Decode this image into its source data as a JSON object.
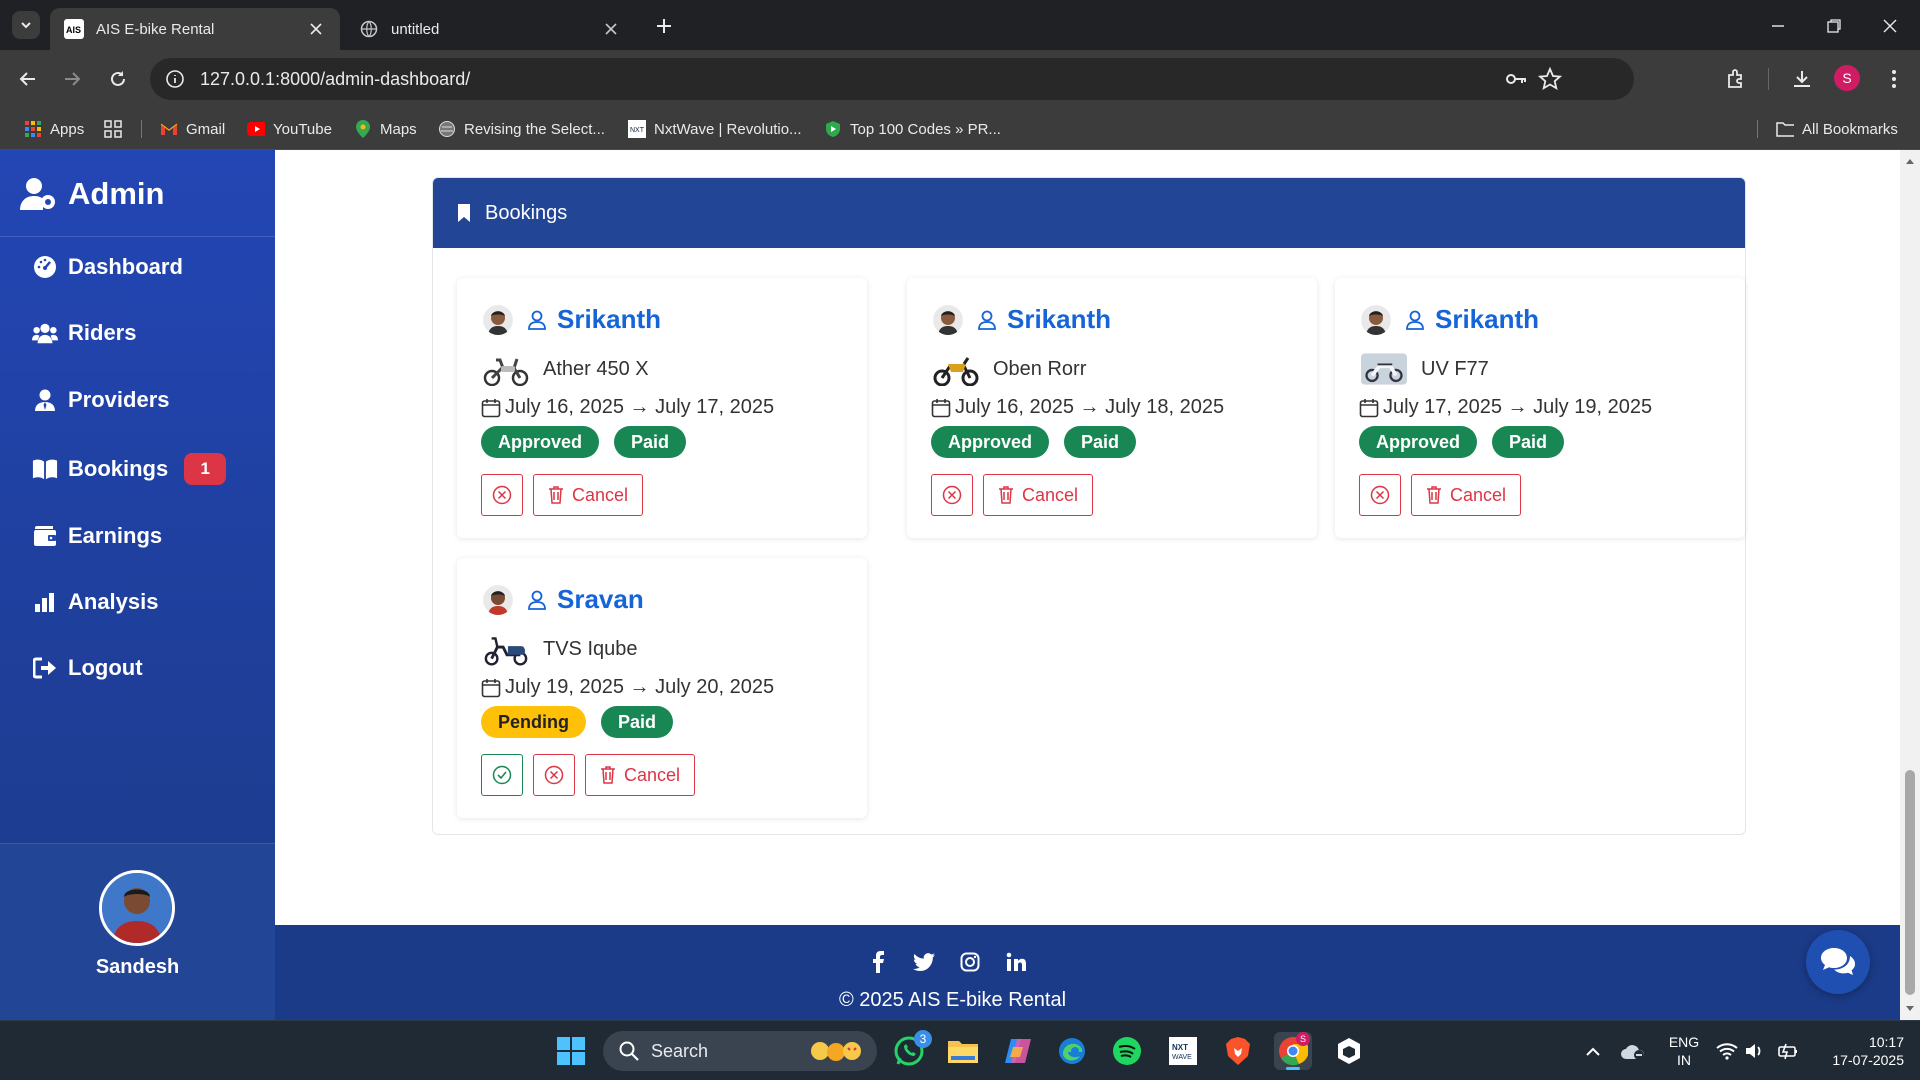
{
  "browser": {
    "tabs": [
      {
        "title": "AIS E-bike Rental",
        "active": true
      },
      {
        "title": "untitled",
        "active": false
      }
    ],
    "url": "127.0.0.1:8000/admin-dashboard/",
    "profile_letter": "S",
    "bookmarks": [
      "Apps",
      "Gmail",
      "YouTube",
      "Maps",
      "Revising the Select...",
      "NxtWave | Revolutio...",
      "Top 100 Codes » PR..."
    ],
    "all_bookmarks": "All Bookmarks"
  },
  "sidebar": {
    "brand": "Admin",
    "items": [
      {
        "label": "Dashboard",
        "icon": "gauge-icon"
      },
      {
        "label": "Riders",
        "icon": "users-icon"
      },
      {
        "label": "Providers",
        "icon": "user-tie-icon"
      },
      {
        "label": "Bookings",
        "icon": "book-open-icon",
        "badge": "1"
      },
      {
        "label": "Earnings",
        "icon": "wallet-icon"
      },
      {
        "label": "Analysis",
        "icon": "bar-chart-icon"
      },
      {
        "label": "Logout",
        "icon": "sign-out-icon"
      }
    ],
    "user_name": "Sandesh"
  },
  "bookings": {
    "title": "Bookings",
    "cards": [
      {
        "rider": "Srikanth",
        "bike": "Ather 450 X",
        "dates": "July 16, 2025 → July 17, 2025",
        "status": "Approved",
        "payment": "Paid",
        "cancel_label": "Cancel"
      },
      {
        "rider": "Srikanth",
        "bike": "Oben Rorr",
        "dates": "July 16, 2025 → July 18, 2025",
        "status": "Approved",
        "payment": "Paid",
        "cancel_label": "Cancel"
      },
      {
        "rider": "Srikanth",
        "bike": "UV F77",
        "dates": "July 17, 2025 → July 19, 2025",
        "status": "Approved",
        "payment": "Paid",
        "cancel_label": "Cancel"
      },
      {
        "rider": "Sravan",
        "bike": "TVS Iqube",
        "dates": "July 19, 2025 → July 20, 2025",
        "status": "Pending",
        "payment": "Paid",
        "cancel_label": "Cancel"
      }
    ]
  },
  "footer": {
    "copyright": "© 2025 AIS E-bike Rental",
    "social": [
      "facebook-icon",
      "twitter-icon",
      "instagram-icon",
      "linkedin-icon"
    ]
  },
  "taskbar": {
    "search_label": "Search",
    "whatsapp_badge": "3",
    "lang_line1": "ENG",
    "lang_line2": "IN",
    "time": "10:17",
    "date": "17-07-2025"
  },
  "colors": {
    "sidebar": "#2346b5",
    "panel_header": "#224596",
    "footer": "#1b3b88",
    "approved_paid": "#198754",
    "pending": "#ffc107",
    "danger": "#dc3545",
    "link": "#1565d8"
  }
}
